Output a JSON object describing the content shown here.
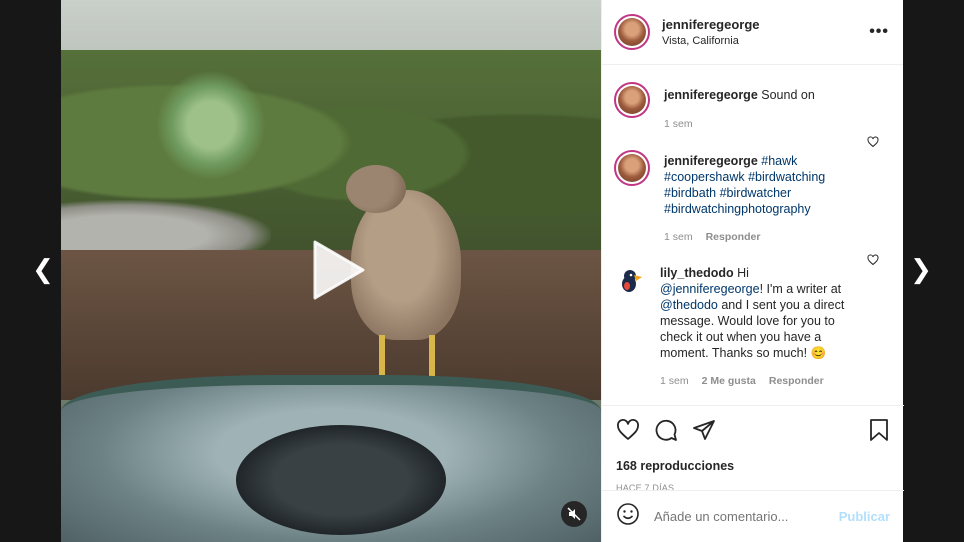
{
  "post": {
    "username": "jenniferegeorge",
    "location": "Vista, California"
  },
  "comments": [
    {
      "username": "jenniferegeorge",
      "text": "Sound on",
      "time": "1 sem"
    },
    {
      "username": "jenniferegeorge",
      "tags": [
        "#hawk",
        "#coopershawk",
        "#birdwatching",
        "#birdbath",
        "#birdwatcher",
        "#birdwatchingphotography"
      ],
      "time": "1 sem",
      "reply": "Responder"
    },
    {
      "username": "lily_thedodo",
      "text_start": "Hi",
      "mention1": "@jenniferegeorge",
      "text_mid": "! I'm a writer at",
      "mention2": "@thedodo",
      "text_end": "and I sent you a direct message. Would love for you to check it out when you have a moment. Thanks so much!",
      "emoji": "😊",
      "time": "1 sem",
      "likes": "2 Me gusta",
      "reply": "Responder"
    }
  ],
  "stats": {
    "views": "168 reproducciones",
    "ago": "HACE 7 DÍAS"
  },
  "add_comment": {
    "placeholder": "Añade un comentario...",
    "publish": "Publicar"
  },
  "icons": {
    "prev": "chevron-left-icon",
    "next": "chevron-right-icon",
    "play": "play-icon",
    "mute": "muted-speaker-icon",
    "like": "heart-icon",
    "comment": "comment-icon",
    "share": "paper-plane-icon",
    "save": "bookmark-icon",
    "emoji": "smiley-icon"
  }
}
